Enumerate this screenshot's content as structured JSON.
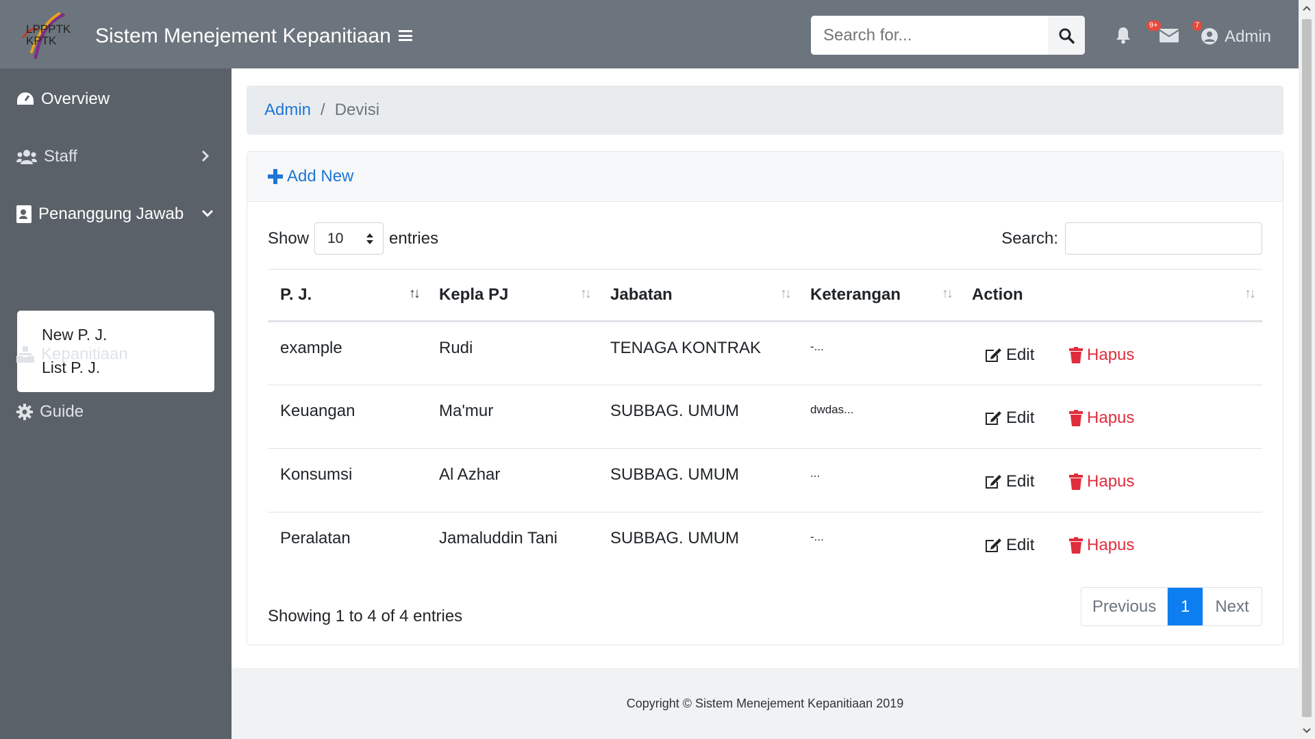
{
  "header": {
    "logo_text_1": "LPPPTK",
    "logo_text_2": "KPTK",
    "title": "Sistem Menejement Kepanitiaan",
    "search_placeholder": "Search for...",
    "notifications_badge": "9+",
    "messages_badge": "7",
    "user_label": "Admin"
  },
  "sidebar": {
    "items": [
      {
        "label": "Overview"
      },
      {
        "label": "Staff"
      },
      {
        "label": "Penanggung Jawab"
      },
      {
        "label": "Kepanitiaan"
      },
      {
        "label": "Guide"
      }
    ],
    "submenu": [
      {
        "label": "New P. J."
      },
      {
        "label": "List P. J."
      }
    ]
  },
  "breadcrumb": {
    "link": "Admin",
    "separator": "/",
    "current": "Devisi"
  },
  "card": {
    "add_new_label": "Add New",
    "show_label": "Show",
    "entries_value": "10",
    "entries_label": "entries",
    "search_label": "Search:",
    "columns": [
      "P. J.",
      "Kepla PJ",
      "Jabatan",
      "Keterangan",
      "Action"
    ],
    "rows": [
      {
        "pj": "example",
        "kepala": "Rudi",
        "jabatan": "TENAGA KONTRAK",
        "keterangan": "-..."
      },
      {
        "pj": "Keuangan",
        "kepala": "Ma'mur",
        "jabatan": "SUBBAG. UMUM",
        "keterangan": "dwdas..."
      },
      {
        "pj": "Konsumsi",
        "kepala": "Al Azhar",
        "jabatan": "SUBBAG. UMUM",
        "keterangan": "..."
      },
      {
        "pj": "Peralatan",
        "kepala": "Jamaluddin Tani",
        "jabatan": "SUBBAG. UMUM",
        "keterangan": "-..."
      }
    ],
    "edit_label": "Edit",
    "delete_label": "Hapus",
    "info": "Showing 1 to 4 of 4 entries",
    "pagination": {
      "previous": "Previous",
      "current": "1",
      "next": "Next"
    }
  },
  "footer": {
    "copyright": "Copyright © Sistem Menejement Kepanitiaan 2019"
  },
  "colors": {
    "topbar": "#6c757d",
    "sidebar": "#5a6168",
    "link": "#1d76d6",
    "danger": "#e02d3c",
    "active_page": "#0d7ef0"
  }
}
